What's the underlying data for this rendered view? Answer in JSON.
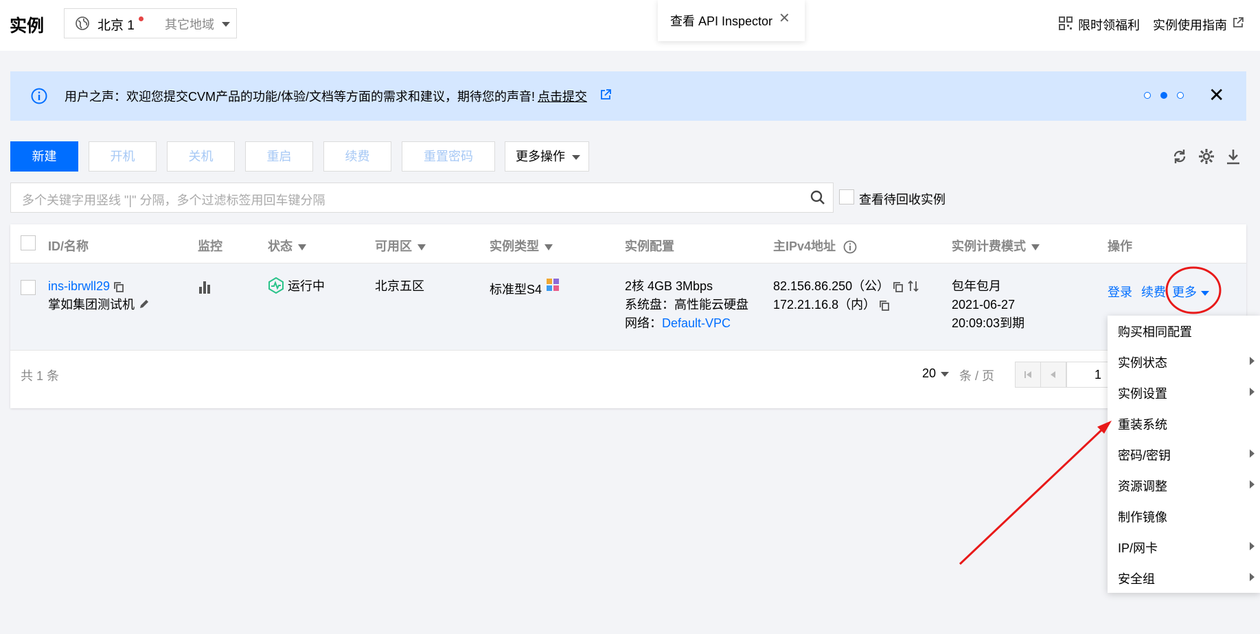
{
  "header": {
    "title": "实例",
    "region_current": "北京 1",
    "region_other": "其它地域",
    "api_inspector": "查看 API Inspector",
    "promo_link": "限时领福利",
    "guide_link": "实例使用指南"
  },
  "banner": {
    "text": "用户之声：欢迎您提交CVM产品的功能/体验/文档等方面的需求和建议，期待您的声音!",
    "link": "点击提交"
  },
  "toolbar": {
    "new": "新建",
    "start": "开机",
    "shutdown": "关机",
    "restart": "重启",
    "renew": "续费",
    "reset_password": "重置密码",
    "more_actions": "更多操作"
  },
  "search": {
    "placeholder": "多个关键字用竖线 \"|\" 分隔，多个过滤标签用回车键分隔",
    "recycle_label": "查看待回收实例"
  },
  "table": {
    "columns": {
      "id_name": "ID/名称",
      "monitor": "监控",
      "status": "状态",
      "zone": "可用区",
      "type": "实例类型",
      "config": "实例配置",
      "ipv4": "主IPv4地址",
      "billing": "实例计费模式",
      "ops": "操作"
    },
    "row": {
      "id": "ins-ibrwll29",
      "name": "掌如集团测试机",
      "status": "运行中",
      "zone": "北京五区",
      "type": "标准型S4",
      "config_line1": "2核 4GB 3Mbps",
      "config_line2": "系统盘：高性能云硬盘",
      "config_line3_prefix": "网络：",
      "config_vpc": "Default-VPC",
      "ip_public": "82.156.86.250（公）",
      "ip_private": "172.21.16.8（内）",
      "billing_line1": "包年包月",
      "billing_line2": "2021-06-27",
      "billing_line3": "20:09:03到期",
      "op_login": "登录",
      "op_renew": "续费",
      "op_more": "更多"
    },
    "footer": {
      "total": "共 1 条",
      "page_size": "20",
      "per_page": "条 / 页",
      "page": "1"
    }
  },
  "more_menu": {
    "items": [
      "购买相同配置",
      "实例状态",
      "实例设置",
      "重装系统",
      "密码/密钥",
      "资源调整",
      "制作镜像",
      "IP/网卡",
      "安全组"
    ]
  },
  "colors": {
    "primary": "#006eff",
    "banner_bg": "#d5e7ff",
    "status_running": "#2bc38a",
    "annotation_red": "#e81919"
  }
}
